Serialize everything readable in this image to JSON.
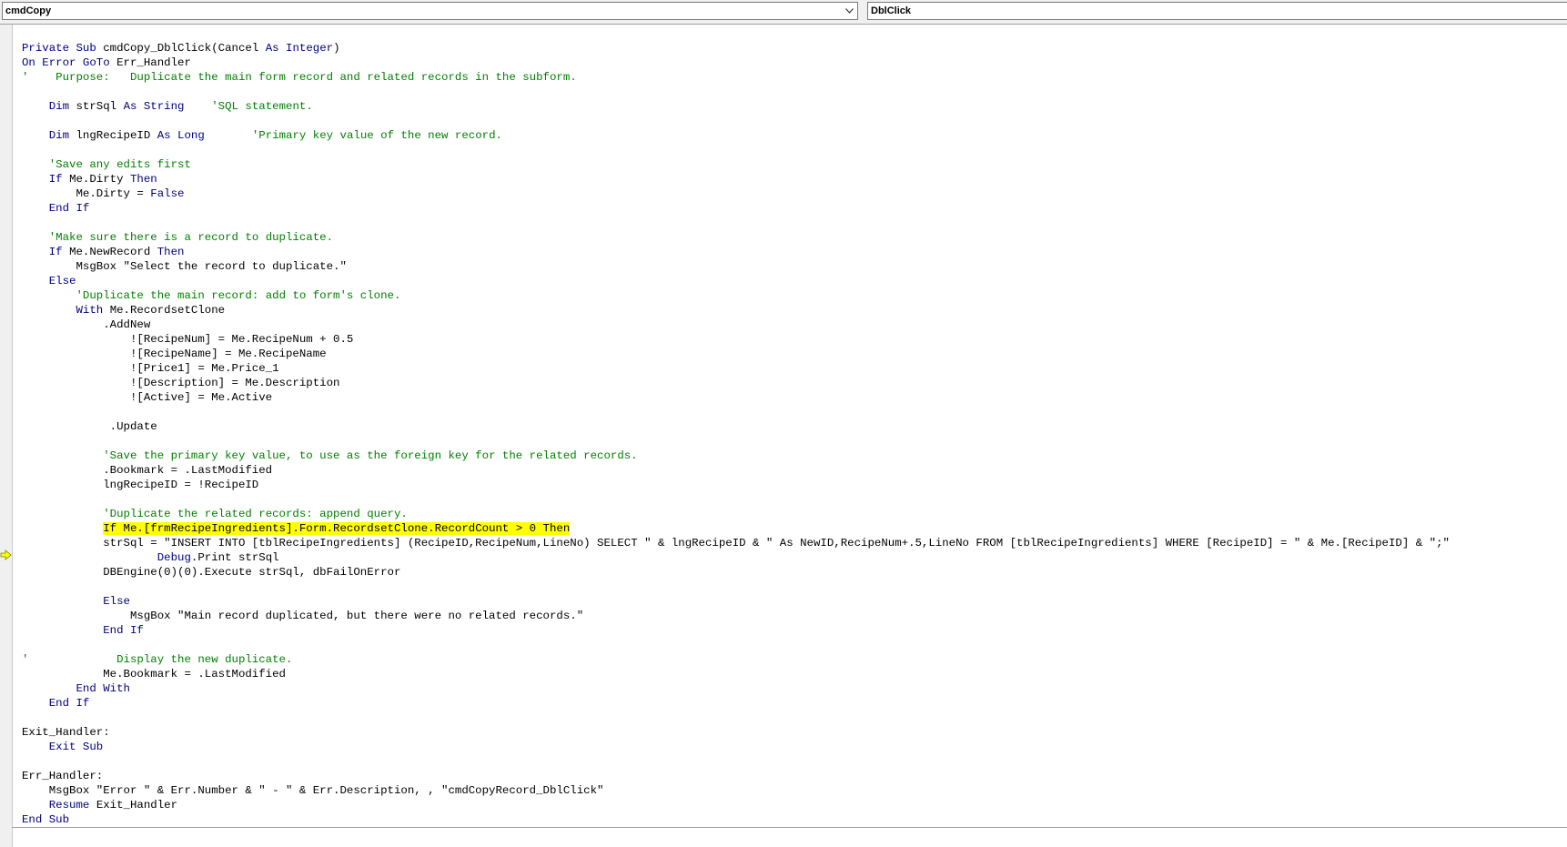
{
  "header": {
    "object_combo": "cmdCopy",
    "procedure_combo": "DblClick"
  },
  "code_lines": [
    [
      {
        "t": "Private Sub ",
        "c": "kw"
      },
      {
        "t": "cmdCopy_DblClick(Cancel "
      },
      {
        "t": "As Integer",
        "c": "kw"
      },
      {
        "t": ")"
      }
    ],
    [
      {
        "t": "On Error GoTo ",
        "c": "kw"
      },
      {
        "t": "Err_Handler"
      }
    ],
    [
      {
        "t": "'    Purpose:   Duplicate the main form record and related records in the subform.",
        "c": "cm"
      }
    ],
    [],
    [
      {
        "t": "    "
      },
      {
        "t": "Dim ",
        "c": "kw"
      },
      {
        "t": "strSql "
      },
      {
        "t": "As String",
        "c": "kw"
      },
      {
        "t": "    "
      },
      {
        "t": "'SQL statement.",
        "c": "cm"
      }
    ],
    [],
    [
      {
        "t": "    "
      },
      {
        "t": "Dim ",
        "c": "kw"
      },
      {
        "t": "lngRecipeID "
      },
      {
        "t": "As Long",
        "c": "kw"
      },
      {
        "t": "       "
      },
      {
        "t": "'Primary key value of the new record.",
        "c": "cm"
      }
    ],
    [],
    [
      {
        "t": "    "
      },
      {
        "t": "'Save any edits first",
        "c": "cm"
      }
    ],
    [
      {
        "t": "    "
      },
      {
        "t": "If ",
        "c": "kw"
      },
      {
        "t": "Me.Dirty "
      },
      {
        "t": "Then",
        "c": "kw"
      }
    ],
    [
      {
        "t": "        Me.Dirty = "
      },
      {
        "t": "False",
        "c": "kw"
      }
    ],
    [
      {
        "t": "    "
      },
      {
        "t": "End If",
        "c": "kw"
      }
    ],
    [],
    [
      {
        "t": "    "
      },
      {
        "t": "'Make sure there is a record to duplicate.",
        "c": "cm"
      }
    ],
    [
      {
        "t": "    "
      },
      {
        "t": "If ",
        "c": "kw"
      },
      {
        "t": "Me.NewRecord "
      },
      {
        "t": "Then",
        "c": "kw"
      }
    ],
    [
      {
        "t": "        MsgBox \"Select the record to duplicate.\""
      }
    ],
    [
      {
        "t": "    "
      },
      {
        "t": "Else",
        "c": "kw"
      }
    ],
    [
      {
        "t": "        "
      },
      {
        "t": "'Duplicate the main record: add to form's clone.",
        "c": "cm"
      }
    ],
    [
      {
        "t": "        "
      },
      {
        "t": "With ",
        "c": "kw"
      },
      {
        "t": "Me.RecordsetClone"
      }
    ],
    [
      {
        "t": "            .AddNew"
      }
    ],
    [
      {
        "t": "                ![RecipeNum] = Me.RecipeNum + 0.5"
      }
    ],
    [
      {
        "t": "                ![RecipeName] = Me.RecipeName"
      }
    ],
    [
      {
        "t": "                ![Price1] = Me.Price_1"
      }
    ],
    [
      {
        "t": "                ![Description] = Me.Description"
      }
    ],
    [
      {
        "t": "                ![Active] = Me.Active"
      }
    ],
    [],
    [
      {
        "t": "             .Update"
      }
    ],
    [],
    [
      {
        "t": "            "
      },
      {
        "t": "'Save the primary key value, to use as the foreign key for the related records.",
        "c": "cm"
      }
    ],
    [
      {
        "t": "            .Bookmark = .LastModified"
      }
    ],
    [
      {
        "t": "            lngRecipeID = !RecipeID"
      }
    ],
    [],
    [
      {
        "t": "            "
      },
      {
        "t": "'Duplicate the related records: append query.",
        "c": "cm"
      }
    ],
    [
      {
        "t": "            "
      },
      {
        "t": "If Me.[frmRecipeIngredients].Form.RecordsetClone.RecordCount > 0 Then",
        "c": "hl"
      }
    ],
    [
      {
        "t": "            strSql = \"INSERT INTO [tblRecipeIngredients] (RecipeID,RecipeNum,LineNo) SELECT \" & lngRecipeID & \" As NewID,RecipeNum+.5,LineNo FROM [tblRecipeIngredients] WHERE [RecipeID] = \" & Me.[RecipeID] & \";\""
      }
    ],
    [
      {
        "t": "                    "
      },
      {
        "t": "Debug",
        "c": "kw"
      },
      {
        "t": ".Print strSql"
      }
    ],
    [
      {
        "t": "            DBEngine(0)(0).Execute strSql, dbFailOnError"
      }
    ],
    [],
    [
      {
        "t": "            "
      },
      {
        "t": "Else",
        "c": "kw"
      }
    ],
    [
      {
        "t": "                MsgBox \"Main record duplicated, but there were no related records.\""
      }
    ],
    [
      {
        "t": "            "
      },
      {
        "t": "End If",
        "c": "kw"
      }
    ],
    [],
    [
      {
        "t": "'             Display the new duplicate.",
        "c": "cm"
      }
    ],
    [
      {
        "t": "            Me.Bookmark = .LastModified"
      }
    ],
    [
      {
        "t": "        "
      },
      {
        "t": "End With",
        "c": "kw"
      }
    ],
    [
      {
        "t": "    "
      },
      {
        "t": "End If",
        "c": "kw"
      }
    ],
    [],
    [
      {
        "t": "Exit_Handler:"
      }
    ],
    [
      {
        "t": "    "
      },
      {
        "t": "Exit Sub",
        "c": "kw"
      }
    ],
    [],
    [
      {
        "t": "Err_Handler:"
      }
    ],
    [
      {
        "t": "    MsgBox \"Error \" & Err.Number & \" - \" & Err.Description, , \"cmdCopyRecord_DblClick\""
      }
    ],
    [
      {
        "t": "    "
      },
      {
        "t": "Resume ",
        "c": "kw"
      },
      {
        "t": "Exit_Handler"
      }
    ],
    [
      {
        "t": "End Sub",
        "c": "kw"
      }
    ]
  ],
  "colors": {
    "keyword": "#00007f",
    "comment": "#007f00",
    "highlight": "#ffff00",
    "exec_arrow": "#ffff00"
  },
  "icons": {
    "dropdown": "chevron-down-icon",
    "execution_point": "execution-arrow-icon"
  }
}
